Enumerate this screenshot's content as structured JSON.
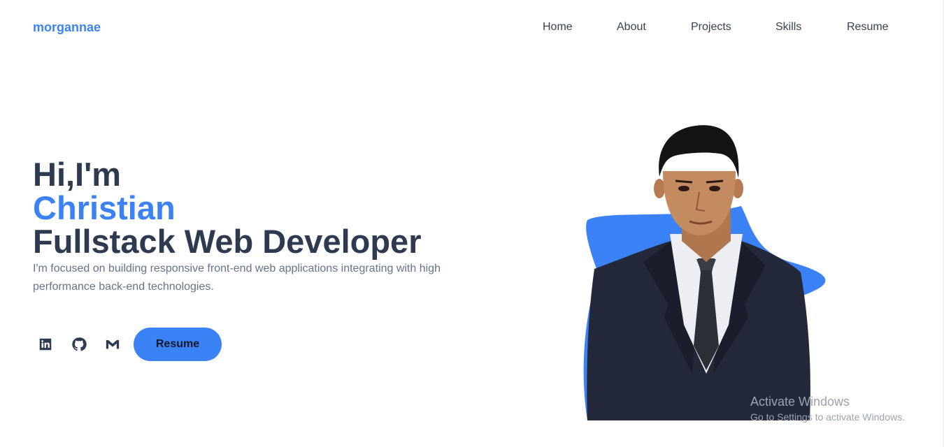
{
  "header": {
    "logo": "morgannae",
    "nav": [
      "Home",
      "About",
      "Projects",
      "Skills",
      "Resume"
    ]
  },
  "hero": {
    "greeting": "Hi,I'm",
    "name": "Christian",
    "role": "Fullstack Web Developer",
    "description": "I'm focused on building responsive front-end web applications integrating with high performance back-end technologies.",
    "resume_label": "Resume",
    "socials": [
      "linkedin-icon",
      "github-icon",
      "gmail-icon"
    ]
  },
  "watermark": {
    "title": "Activate Windows",
    "subtitle": "Go to Settings to activate Windows."
  },
  "colors": {
    "accent": "#3b82f6",
    "heading": "#2d3a4f",
    "body_text": "#64748b",
    "nav_text": "#374151"
  }
}
